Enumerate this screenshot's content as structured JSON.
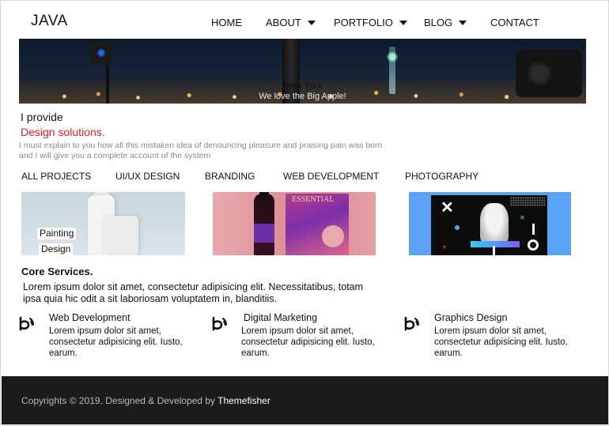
{
  "brand": {
    "name": "JAVA"
  },
  "nav": {
    "items": [
      {
        "label": "HOME",
        "dropdown": false
      },
      {
        "label": "ABOUT",
        "dropdown": true
      },
      {
        "label": "PORTFOLIO",
        "dropdown": true
      },
      {
        "label": "BLOG",
        "dropdown": true
      },
      {
        "label": "CONTACT",
        "dropdown": false
      }
    ]
  },
  "hero": {
    "title": "New York",
    "subtitle": "We love the Big Apple!"
  },
  "intro": {
    "line1": "I provide",
    "line2": "Design solutions.",
    "line3": "I must explain to you how all this mistaken idea of denouncing pleasure and praising pain was born and I will give you a complete account of the system"
  },
  "filters": [
    "ALL PROJECTS",
    "UI/UX DESIGN",
    "BRANDING",
    "WEB DEVELOPMENT",
    "PHOTOGRAPHY"
  ],
  "portfolio": {
    "card1_label1": "Painting",
    "card1_label2": "Design",
    "card2_title": "ESSENTIAL"
  },
  "core": {
    "title": "Core Services.",
    "text": "Lorem ipsum dolor sit amet, consectetur adipisicing elit. Necessitatibus, totam ipsa quia hic odit a sit laboriosam voluptatem in, blanditiis."
  },
  "services": [
    {
      "title": "Web Development",
      "text": "Lorem ipsum dolor sit amet, consectetur adipisicing elit. Iusto, earum.",
      "icon": "behance-icon"
    },
    {
      "title": "Digital Marketing",
      "text": "Lorem ipsum dolor sit amet, consectetur adipisicing elit. Iusto, earum.",
      "icon": "behance-icon"
    },
    {
      "title": "Graphics Design",
      "text": "Lorem ipsum dolor sit amet, consectetur adipisicing elit. Iusto, earum.",
      "icon": "behance-icon"
    }
  ],
  "footer": {
    "text": "Copyrights © 2019. Designed & Developed by",
    "link": "Themefisher"
  },
  "colors": {
    "accent": "#e11d2a",
    "footer_bg": "#1b1b1b"
  }
}
